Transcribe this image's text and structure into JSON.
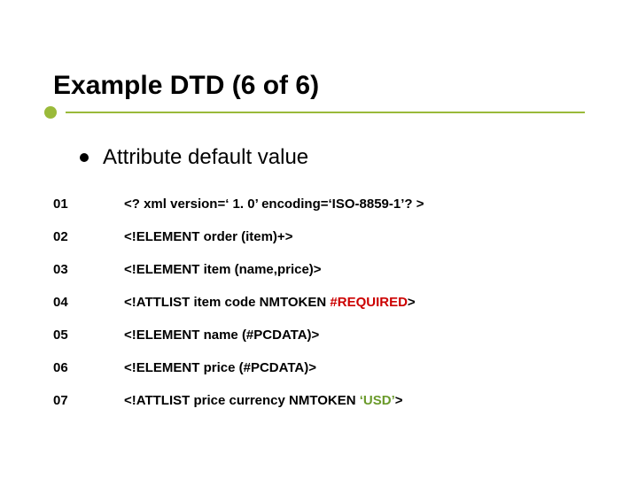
{
  "title": "Example DTD (6 of 6)",
  "subtitle": "Attribute default value",
  "rows": [
    {
      "num": "01",
      "text_before": "<? xml version=‘ 1. 0’ encoding=‘ISO-8859-1’? >",
      "highlight": "",
      "highlight_class": "",
      "text_after": ""
    },
    {
      "num": "02",
      "text_before": "<!ELEMENT order (item)+>",
      "highlight": "",
      "highlight_class": "",
      "text_after": ""
    },
    {
      "num": "03",
      "text_before": "<!ELEMENT item (name,price)>",
      "highlight": "",
      "highlight_class": "",
      "text_after": ""
    },
    {
      "num": "04",
      "text_before": "<!ATTLIST item code NMTOKEN ",
      "highlight": "#REQUIRED",
      "highlight_class": "hl-red",
      "text_after": ">"
    },
    {
      "num": "05",
      "text_before": "<!ELEMENT name (#PCDATA)>",
      "highlight": "",
      "highlight_class": "",
      "text_after": ""
    },
    {
      "num": "06",
      "text_before": "<!ELEMENT price (#PCDATA)>",
      "highlight": "",
      "highlight_class": "",
      "text_after": ""
    },
    {
      "num": "07",
      "text_before": "<!ATTLIST price currency NMTOKEN ",
      "highlight": "‘USD’",
      "highlight_class": "hl-green",
      "text_after": ">"
    }
  ]
}
